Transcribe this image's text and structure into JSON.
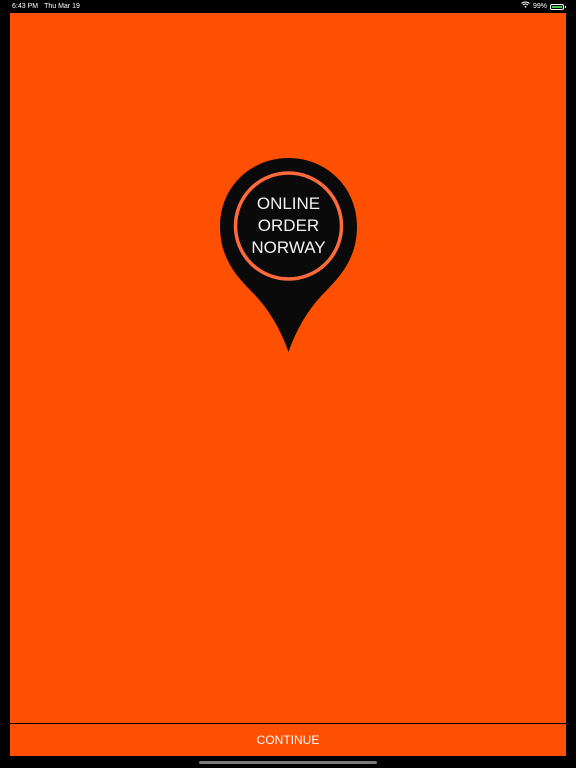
{
  "status_bar": {
    "time": "6:43 PM",
    "date": "Thu Mar 19",
    "battery_percent": "99%",
    "battery_level": 0.99,
    "wifi_icon": "wifi-icon",
    "battery_icon": "battery-charging-icon"
  },
  "logo": {
    "line1": "ONLINE",
    "line2": "ORDER",
    "line3": "NORWAY",
    "pin_color": "#0a0a0a",
    "ring_color": "#ff6a3d"
  },
  "actions": {
    "continue_label": "CONTINUE"
  },
  "colors": {
    "background": "#ff4f00",
    "frame": "#000000"
  }
}
